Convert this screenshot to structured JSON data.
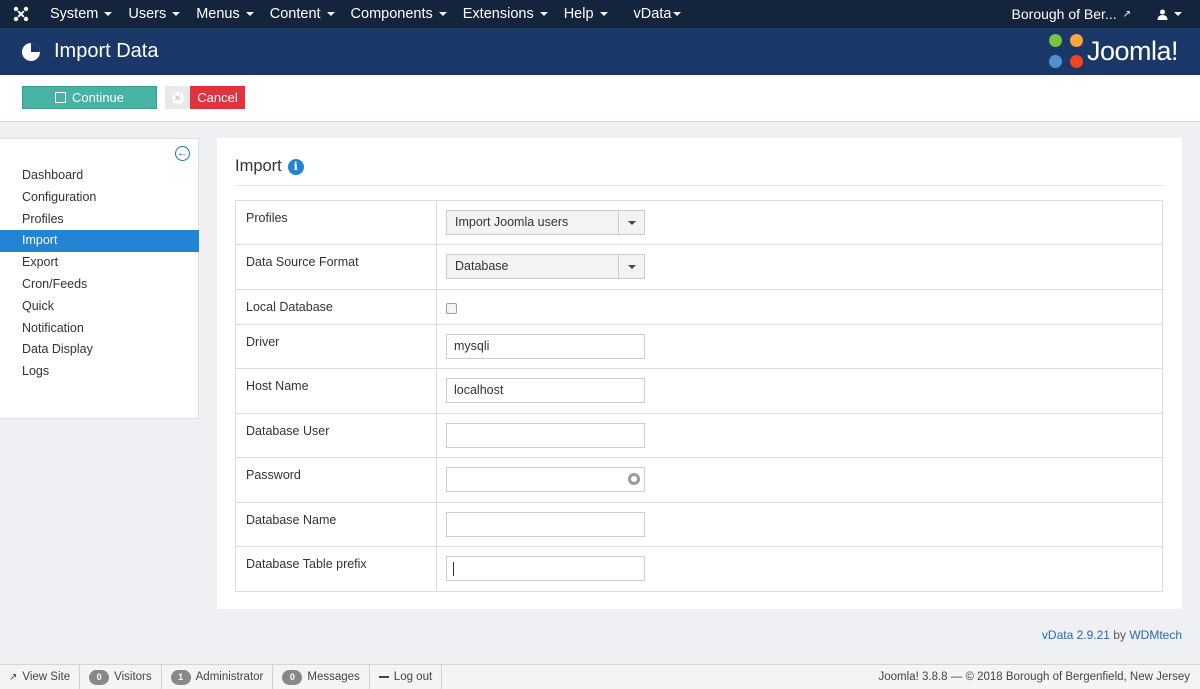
{
  "topnav": {
    "menu": [
      {
        "label": "System"
      },
      {
        "label": "Users"
      },
      {
        "label": "Menus"
      },
      {
        "label": "Content"
      },
      {
        "label": "Components"
      },
      {
        "label": "Extensions"
      },
      {
        "label": "Help"
      },
      {
        "label": "vData"
      }
    ],
    "site_name": "Borough of Ber...",
    "icons": {
      "logo": "joomla-logo-icon",
      "external": "external-link-icon",
      "user": "user-icon"
    }
  },
  "header": {
    "title": "Import Data",
    "brand": "Joomla!",
    "brand_colors": [
      "#7ac143",
      "#f9a541",
      "#f44321",
      "#5091cd"
    ]
  },
  "toolbar": {
    "continue_label": "Continue",
    "cancel_label": "Cancel"
  },
  "sidebar": {
    "items": [
      {
        "label": "Dashboard"
      },
      {
        "label": "Configuration"
      },
      {
        "label": "Profiles"
      },
      {
        "label": "Import",
        "active": true
      },
      {
        "label": "Export"
      },
      {
        "label": "Cron/Feeds"
      },
      {
        "label": "Quick"
      },
      {
        "label": "Notification"
      },
      {
        "label": "Data Display"
      },
      {
        "label": "Logs"
      }
    ]
  },
  "main": {
    "section_title": "Import",
    "fields": {
      "profiles": {
        "label": "Profiles",
        "value": "Import Joomla users"
      },
      "format": {
        "label": "Data Source Format",
        "value": "Database"
      },
      "local_db": {
        "label": "Local Database",
        "checked": false
      },
      "driver": {
        "label": "Driver",
        "value": "mysqli"
      },
      "host": {
        "label": "Host Name",
        "value": "localhost"
      },
      "db_user": {
        "label": "Database User",
        "value": ""
      },
      "password": {
        "label": "Password",
        "value": ""
      },
      "db_name": {
        "label": "Database Name",
        "value": ""
      },
      "table_prefix": {
        "label": "Database Table prefix",
        "value": ""
      }
    }
  },
  "version": {
    "text": "vData 2.9.21",
    "by": "by",
    "vendor": "WDMtech"
  },
  "footer": {
    "view_site": "View Site",
    "visitors_count": "0",
    "visitors_label": "Visitors",
    "admin_count": "1",
    "admin_label": "Administrator",
    "messages_count": "0",
    "messages_label": "Messages",
    "logout": "Log out",
    "copyright": "Joomla! 3.8.8 — © 2018 Borough of Bergenfield, New Jersey"
  },
  "colors": {
    "navbar": "#14243d",
    "header": "#1a3867",
    "continue": "#46b3a5",
    "cancel": "#e2323f",
    "active_sidebar": "#2384d3"
  }
}
